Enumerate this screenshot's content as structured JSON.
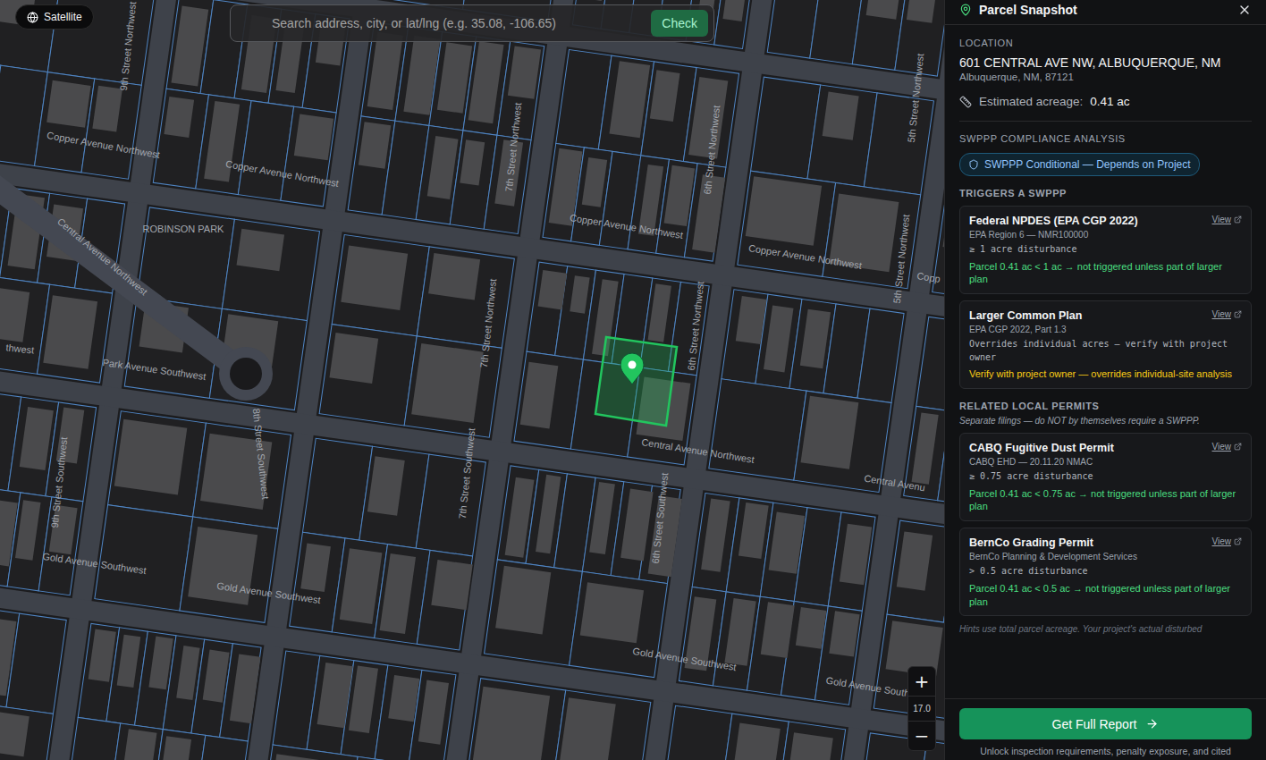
{
  "map": {
    "mode_button": "Satellite",
    "search": {
      "placeholder": "Search address, city, or lat/lng (e.g. 35.08, -106.65)",
      "button": "Check"
    },
    "zoom": {
      "in": "+",
      "level": "17.0",
      "out": "−"
    },
    "labels": [
      {
        "text": "Copper Avenue Northwest"
      },
      {
        "text": "Copper Avenue Northwest"
      },
      {
        "text": "Copper Avenue Northwest"
      },
      {
        "text": "Copper Avenue Northwest"
      },
      {
        "text": "Copp"
      },
      {
        "text": "Central Avenue Northwest"
      },
      {
        "text": "ROBINSON PARK"
      },
      {
        "text": "thwest"
      },
      {
        "text": "Park Avenue Southwest"
      },
      {
        "text": "Central Avenue Northwest"
      },
      {
        "text": "Central Avenu"
      },
      {
        "text": "Gold Avenue Southwest"
      },
      {
        "text": "Gold Avenue Southwest"
      },
      {
        "text": "Gold Avenue Southwest"
      },
      {
        "text": "Gold Avenue South"
      },
      {
        "text": "9th Street Northwest"
      },
      {
        "text": "7th Street Northwest"
      },
      {
        "text": "6th Street Northwest"
      },
      {
        "text": "7th Street Northwest"
      },
      {
        "text": "6th Street Northwest"
      },
      {
        "text": "5th Street Northwest"
      },
      {
        "text": "5th Street Northwest"
      },
      {
        "text": "9th Street Southwest"
      },
      {
        "text": "8th Street Southwest"
      },
      {
        "text": "7th Street Southwest"
      },
      {
        "text": "6th Street Southwest"
      }
    ]
  },
  "panel": {
    "title": "Parcel Snapshot",
    "location": {
      "heading": "LOCATION",
      "address": "601 CENTRAL AVE NW, ALBUQUERQUE, NM",
      "city": "Albuquerque, NM, 87121",
      "acreage_label": "Estimated acreage:",
      "acreage": "0.41 ac"
    },
    "analysis": {
      "heading": "SWPPP COMPLIANCE ANALYSIS",
      "badge": "SWPPP Conditional — Depends on Project"
    },
    "triggers": {
      "heading": "TRIGGERS A SWPPP",
      "cards": [
        {
          "title": "Federal NPDES (EPA CGP 2022)",
          "link": "View",
          "source": "EPA Region 6 — NMR100000",
          "rule": "≥ 1 acre disturbance",
          "result": "Parcel 0.41 ac < 1 ac → not triggered unless part of larger plan",
          "color": "#4ade80"
        },
        {
          "title": "Larger Common Plan",
          "link": "View",
          "source": "EPA CGP 2022, Part 1.3",
          "rule": "Overrides individual acres — verify with project owner",
          "result": "Verify with project owner — overrides individual-site analysis",
          "color": "#facc15"
        }
      ]
    },
    "related": {
      "heading": "RELATED LOCAL PERMITS",
      "note": "Separate filings — do NOT by themselves require a SWPPP.",
      "cards": [
        {
          "title": "CABQ Fugitive Dust Permit",
          "link": "View",
          "source": "CABQ EHD — 20.11.20 NMAC",
          "rule": "≥ 0.75 acre disturbance",
          "result": "Parcel 0.41 ac < 0.75 ac → not triggered unless part of larger plan",
          "color": "#4ade80"
        },
        {
          "title": "BernCo Grading Permit",
          "link": "View",
          "source": "BernCo Planning & Development Services",
          "rule": "> 0.5 acre disturbance",
          "result": "Parcel 0.41 ac < 0.5 ac → not triggered unless part of larger plan",
          "color": "#4ade80"
        }
      ]
    },
    "hint": "Hints use total parcel acreage. Your project's actual disturbed",
    "footer": {
      "button": "Get Full Report",
      "note": "Unlock inspection requirements, penalty exposure, and cited"
    }
  }
}
